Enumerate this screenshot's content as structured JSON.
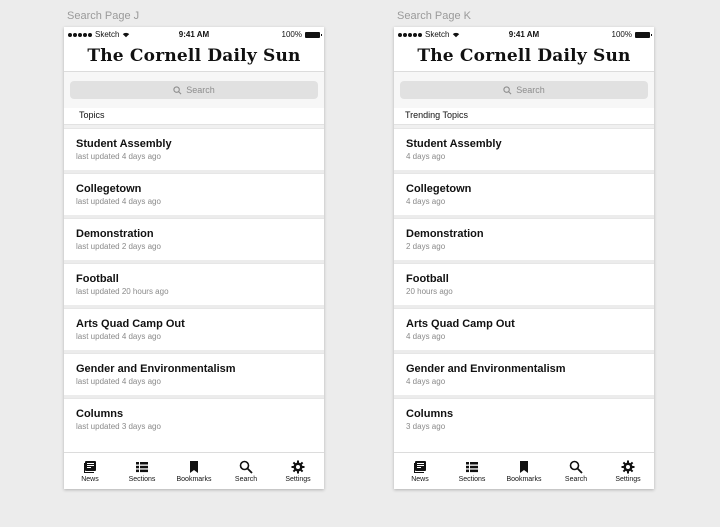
{
  "artboards": [
    {
      "label": "Search Page J",
      "status": {
        "carrier": "Sketch",
        "time": "9:41 AM",
        "battery": "100%"
      },
      "masthead": "The Cornell Daily Sun",
      "search": {
        "placeholder": "Search"
      },
      "section_title": "Topics",
      "items": [
        {
          "title": "Student Assembly",
          "subtitle": "last updated 4 days ago"
        },
        {
          "title": "Collegetown",
          "subtitle": "last updated 4 days ago"
        },
        {
          "title": "Demonstration",
          "subtitle": "last updated 2 days ago"
        },
        {
          "title": "Football",
          "subtitle": "last updated 20 hours ago"
        },
        {
          "title": "Arts Quad Camp Out",
          "subtitle": "last updated 4 days ago"
        },
        {
          "title": "Gender and Environmentalism",
          "subtitle": "last updated 4 days ago"
        },
        {
          "title": "Columns",
          "subtitle": "last updated 3 days ago"
        }
      ],
      "tabs": [
        {
          "label": "News",
          "icon": "news-icon"
        },
        {
          "label": "Sections",
          "icon": "sections-icon"
        },
        {
          "label": "Bookmarks",
          "icon": "bookmark-icon"
        },
        {
          "label": "Search",
          "icon": "search-icon"
        },
        {
          "label": "Settings",
          "icon": "gear-icon"
        }
      ]
    },
    {
      "label": "Search Page K",
      "status": {
        "carrier": "Sketch",
        "time": "9:41 AM",
        "battery": "100%"
      },
      "masthead": "The Cornell Daily Sun",
      "search": {
        "placeholder": "Search"
      },
      "section_title": "Trending Topics",
      "items": [
        {
          "title": "Student Assembly",
          "subtitle": "4 days ago"
        },
        {
          "title": "Collegetown",
          "subtitle": "4 days ago"
        },
        {
          "title": "Demonstration",
          "subtitle": "2 days ago"
        },
        {
          "title": "Football",
          "subtitle": "20 hours ago"
        },
        {
          "title": "Arts Quad Camp Out",
          "subtitle": "4 days ago"
        },
        {
          "title": "Gender and Environmentalism",
          "subtitle": "4 days ago"
        },
        {
          "title": "Columns",
          "subtitle": "3 days ago"
        }
      ],
      "tabs": [
        {
          "label": "News",
          "icon": "news-icon"
        },
        {
          "label": "Sections",
          "icon": "sections-icon"
        },
        {
          "label": "Bookmarks",
          "icon": "bookmark-icon"
        },
        {
          "label": "Search",
          "icon": "search-icon"
        },
        {
          "label": "Settings",
          "icon": "gear-icon"
        }
      ]
    }
  ]
}
